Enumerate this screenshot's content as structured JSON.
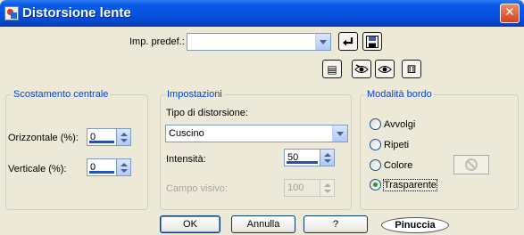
{
  "window": {
    "title": "Distorsione lente",
    "close_glyph": "✕"
  },
  "preset": {
    "label": "Imp. predef.:",
    "value": ""
  },
  "toolbar": {
    "reset_icon": "reset-icon",
    "save_icon": "save-icon",
    "preview_glyph": "▤",
    "randomize_glyph": "⚅"
  },
  "groups": {
    "center": {
      "title": "Scostamento centrale",
      "horizontal_label": "Orizzontale (%):",
      "horizontal_value": "0",
      "vertical_label": "Verticale (%):",
      "vertical_value": "0"
    },
    "settings": {
      "title": "Impostazioni",
      "type_label": "Tipo di distorsione:",
      "type_value": "Cuscino",
      "intensity_label": "Intensità:",
      "intensity_value": "50",
      "fov_label": "Campo visivo:",
      "fov_value": "100"
    },
    "edge": {
      "title": "Modalità bordo",
      "options": [
        "Avvolgi",
        "Ripeti",
        "Colore",
        "Trasparente"
      ],
      "selected": "Trasparente",
      "color_glyph": "⃠"
    }
  },
  "buttons": {
    "ok": "OK",
    "cancel": "Annulla",
    "help": "?"
  },
  "watermark": "Pinuccia",
  "colors": {
    "title_blue": "#0551e0",
    "group_title": "#0046d5",
    "background": "#ece9d8"
  }
}
